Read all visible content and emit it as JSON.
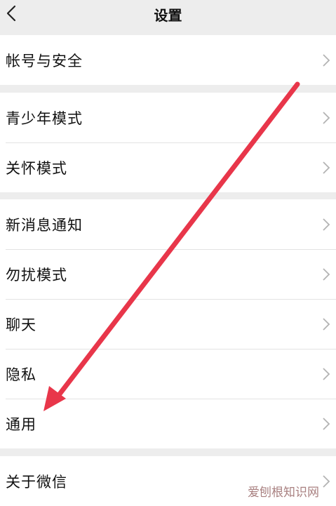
{
  "header": {
    "title": "设置",
    "back_icon": "chevron-left-icon"
  },
  "groups": [
    {
      "items": [
        {
          "label": "帐号与安全"
        }
      ]
    },
    {
      "items": [
        {
          "label": "青少年模式"
        },
        {
          "label": "关怀模式"
        }
      ]
    },
    {
      "items": [
        {
          "label": "新消息通知"
        },
        {
          "label": "勿扰模式"
        },
        {
          "label": "聊天"
        },
        {
          "label": "隐私"
        },
        {
          "label": "通用"
        }
      ]
    },
    {
      "items": [
        {
          "label": "关于微信"
        }
      ]
    }
  ],
  "annotation": {
    "arrow_color": "#e8364a"
  },
  "watermark": "爱刨根知识网",
  "colors": {
    "background": "#ededed",
    "row": "#ffffff",
    "chevron": "#b3b3b3"
  }
}
